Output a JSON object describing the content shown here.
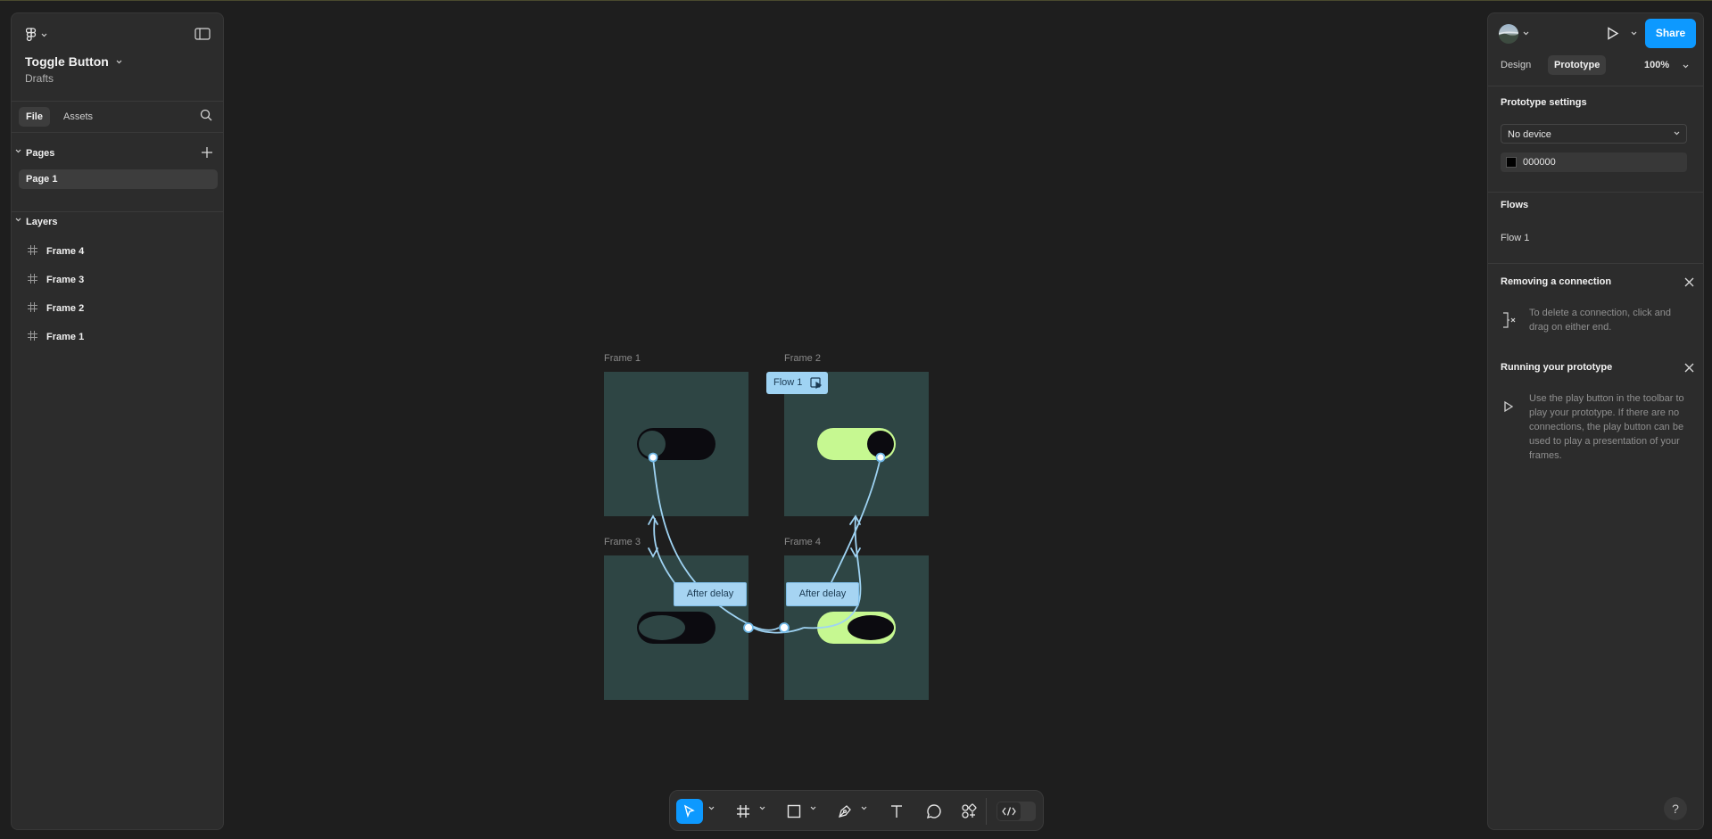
{
  "app": {
    "file_title": "Toggle Button",
    "file_location": "Drafts"
  },
  "left_panel": {
    "tabs": [
      {
        "label": "File",
        "active": true
      },
      {
        "label": "Assets",
        "active": false
      }
    ],
    "pages_header": "Pages",
    "pages": [
      "Page 1"
    ],
    "layers_header": "Layers",
    "layers": [
      "Frame 4",
      "Frame 3",
      "Frame 2",
      "Frame 1"
    ]
  },
  "canvas": {
    "background": "#1e1e1e",
    "frame_fill": "#2e4544",
    "frames": [
      {
        "label": "Frame 1",
        "toggle_state": "off",
        "track": "#0c0b10",
        "knob": "#2e4544"
      },
      {
        "label": "Frame 2",
        "toggle_state": "on",
        "track": "#c6f891",
        "knob": "#0c0b10"
      },
      {
        "label": "Frame 3",
        "toggle_state": "off-transition",
        "track": "#0c0b10",
        "knob": "#2e4544"
      },
      {
        "label": "Frame 4",
        "toggle_state": "on-transition",
        "track": "#c6f891",
        "knob": "#0c0b10"
      }
    ],
    "flow_start": {
      "label": "Flow 1",
      "icon": "play-frame-icon"
    },
    "connections": [
      {
        "trigger": "After delay"
      },
      {
        "trigger": "After delay"
      }
    ],
    "connection_color": "#9fd3f3"
  },
  "toolbar": {
    "tools": [
      "move-tool",
      "frame-tool",
      "rectangle-tool",
      "pen-tool",
      "text-tool",
      "comment-tool",
      "actions-tool"
    ],
    "active_tool": "move-tool",
    "dev_mode_icon": "code-icon",
    "accent": "#0d99ff"
  },
  "right_panel": {
    "share_label": "Share",
    "tabs": [
      {
        "label": "Design",
        "active": false
      },
      {
        "label": "Prototype",
        "active": true
      }
    ],
    "zoom": "100%",
    "prototype_settings": {
      "header": "Prototype settings",
      "device": "No device",
      "background_hex": "000000",
      "background_color": "#000000"
    },
    "flows_header": "Flows",
    "flows": [
      "Flow 1"
    ],
    "tips": [
      {
        "title": "Removing a connection",
        "text": "To delete a connection, click and drag on either end.",
        "icon": "remove-connection-icon"
      },
      {
        "title": "Running your prototype",
        "text": "Use the play button in the toolbar to play your prototype. If there are no connections, the play button can be used to play a presentation of your frames.",
        "icon": "play-icon"
      }
    ],
    "help_label": "?"
  }
}
